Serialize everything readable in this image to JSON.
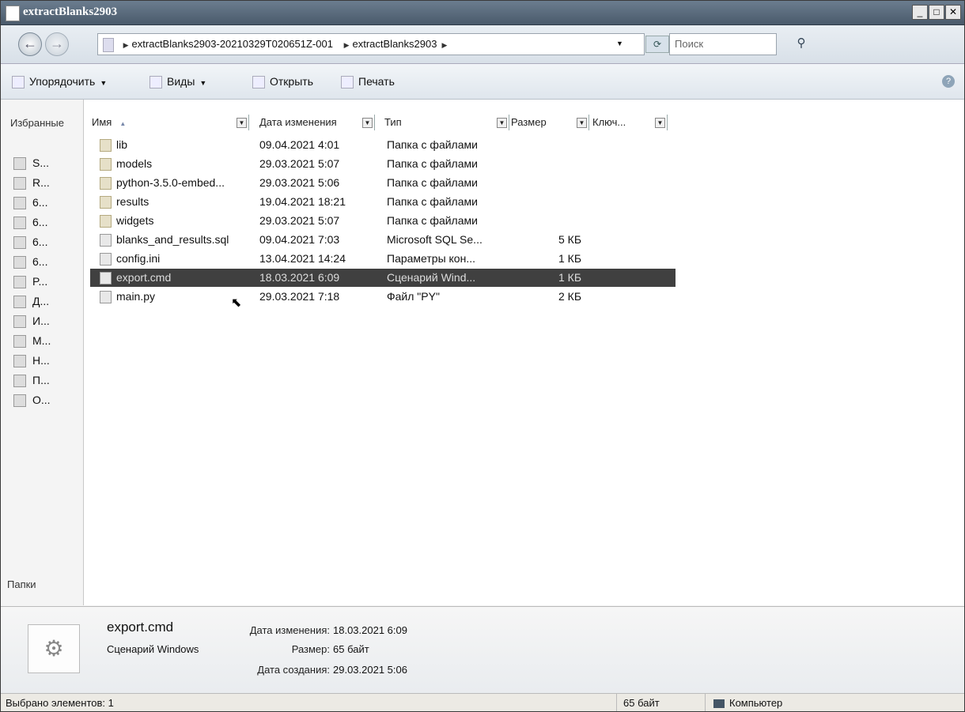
{
  "window": {
    "title": "extractBlanks2903",
    "min_label": "_",
    "max_label": "□",
    "close_label": "✕"
  },
  "address": {
    "crumbs": [
      "extractBlanks2903-20210329T020651Z-001",
      "extractBlanks2903"
    ],
    "search_placeholder": "Поиск"
  },
  "toolbar": {
    "organize": "Упорядочить",
    "views": "Виды",
    "open": "Открыть",
    "print": "Печать"
  },
  "nav": {
    "header": "Избранные",
    "items": [
      "S...",
      "R...",
      "6...",
      "6...",
      "6...",
      "6...",
      "P...",
      "Д...",
      "И...",
      "M...",
      "H...",
      "П...",
      "O..."
    ],
    "folders_label": "Папки"
  },
  "columns": {
    "name": "Имя",
    "date": "Дата изменения",
    "type": "Тип",
    "size": "Размер",
    "keys": "Ключ..."
  },
  "files": [
    {
      "name": "lib",
      "date": "09.04.2021 4:01",
      "type": "Папка с файлами",
      "size": "",
      "icon": "folder-icon"
    },
    {
      "name": "models",
      "date": "29.03.2021 5:07",
      "type": "Папка с файлами",
      "size": "",
      "icon": "folder-icon"
    },
    {
      "name": "python-3.5.0-embed...",
      "date": "29.03.2021 5:06",
      "type": "Папка с файлами",
      "size": "",
      "icon": "folder-icon"
    },
    {
      "name": "results",
      "date": "19.04.2021 18:21",
      "type": "Папка с файлами",
      "size": "",
      "icon": "folder-icon"
    },
    {
      "name": "widgets",
      "date": "29.03.2021 5:07",
      "type": "Папка с файлами",
      "size": "",
      "icon": "folder-icon"
    },
    {
      "name": "blanks_and_results.sql",
      "date": "09.04.2021 7:03",
      "type": "Microsoft SQL Se...",
      "size": "5 КБ",
      "icon": "sql-file-icon"
    },
    {
      "name": "config.ini",
      "date": "13.04.2021 14:24",
      "type": "Параметры кон...",
      "size": "1 КБ",
      "icon": "ini-file-icon"
    },
    {
      "name": "export.cmd",
      "date": "18.03.2021 6:09",
      "type": "Сценарий Wind...",
      "size": "1 КБ",
      "icon": "cmd-file-icon",
      "selected": true
    },
    {
      "name": "main.py",
      "date": "29.03.2021 7:18",
      "type": "Файл \"PY\"",
      "size": "2 КБ",
      "icon": "py-file-icon"
    }
  ],
  "details": {
    "name": "export.cmd",
    "type": "Сценарий Windows",
    "modified_label": "Дата изменения:",
    "modified": "18.03.2021 6:09",
    "size_label": "Размер:",
    "size": "65 байт",
    "created_label": "Дата создания:",
    "created": "29.03.2021 5:06"
  },
  "status": {
    "selected": "Выбрано элементов: 1",
    "size": "65 байт",
    "location": "Компьютер"
  }
}
